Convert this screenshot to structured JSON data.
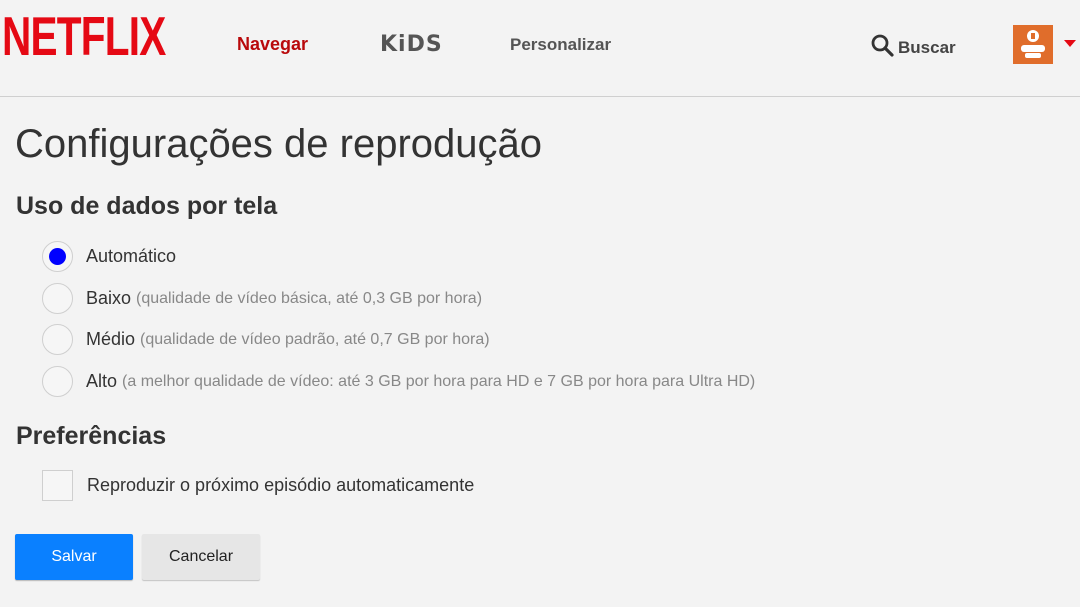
{
  "header": {
    "logo_text": "NETFLIX",
    "nav": {
      "browse": "Navegar",
      "kids": "KiDS",
      "personalize": "Personalizar"
    },
    "search_label": "Buscar",
    "avatar_icon": "profile-avatar-icon",
    "caret_icon": "caret-down-icon"
  },
  "page": {
    "title": "Configurações de reprodução",
    "data_usage": {
      "title": "Uso de dados por tela",
      "options": [
        {
          "label": "Automático",
          "desc": "",
          "selected": true
        },
        {
          "label": "Baixo",
          "desc": "(qualidade de vídeo básica, até 0,3 GB por hora)",
          "selected": false
        },
        {
          "label": "Médio",
          "desc": "(qualidade de vídeo padrão, até 0,7 GB por hora)",
          "selected": false
        },
        {
          "label": "Alto",
          "desc": "(a melhor qualidade de vídeo: até 3 GB por hora para HD e 7 GB por hora para Ultra HD)",
          "selected": false
        }
      ]
    },
    "preferences": {
      "title": "Preferências",
      "autoplay_label": "Reproduzir o próximo episódio automaticamente",
      "autoplay_checked": false
    },
    "buttons": {
      "save": "Salvar",
      "cancel": "Cancelar"
    }
  },
  "colors": {
    "brand": "#e50914",
    "nav_active": "#b9090b",
    "primary_button": "#0a80ff",
    "radio_selected": "#0000ff",
    "background": "#f3f3f3"
  }
}
